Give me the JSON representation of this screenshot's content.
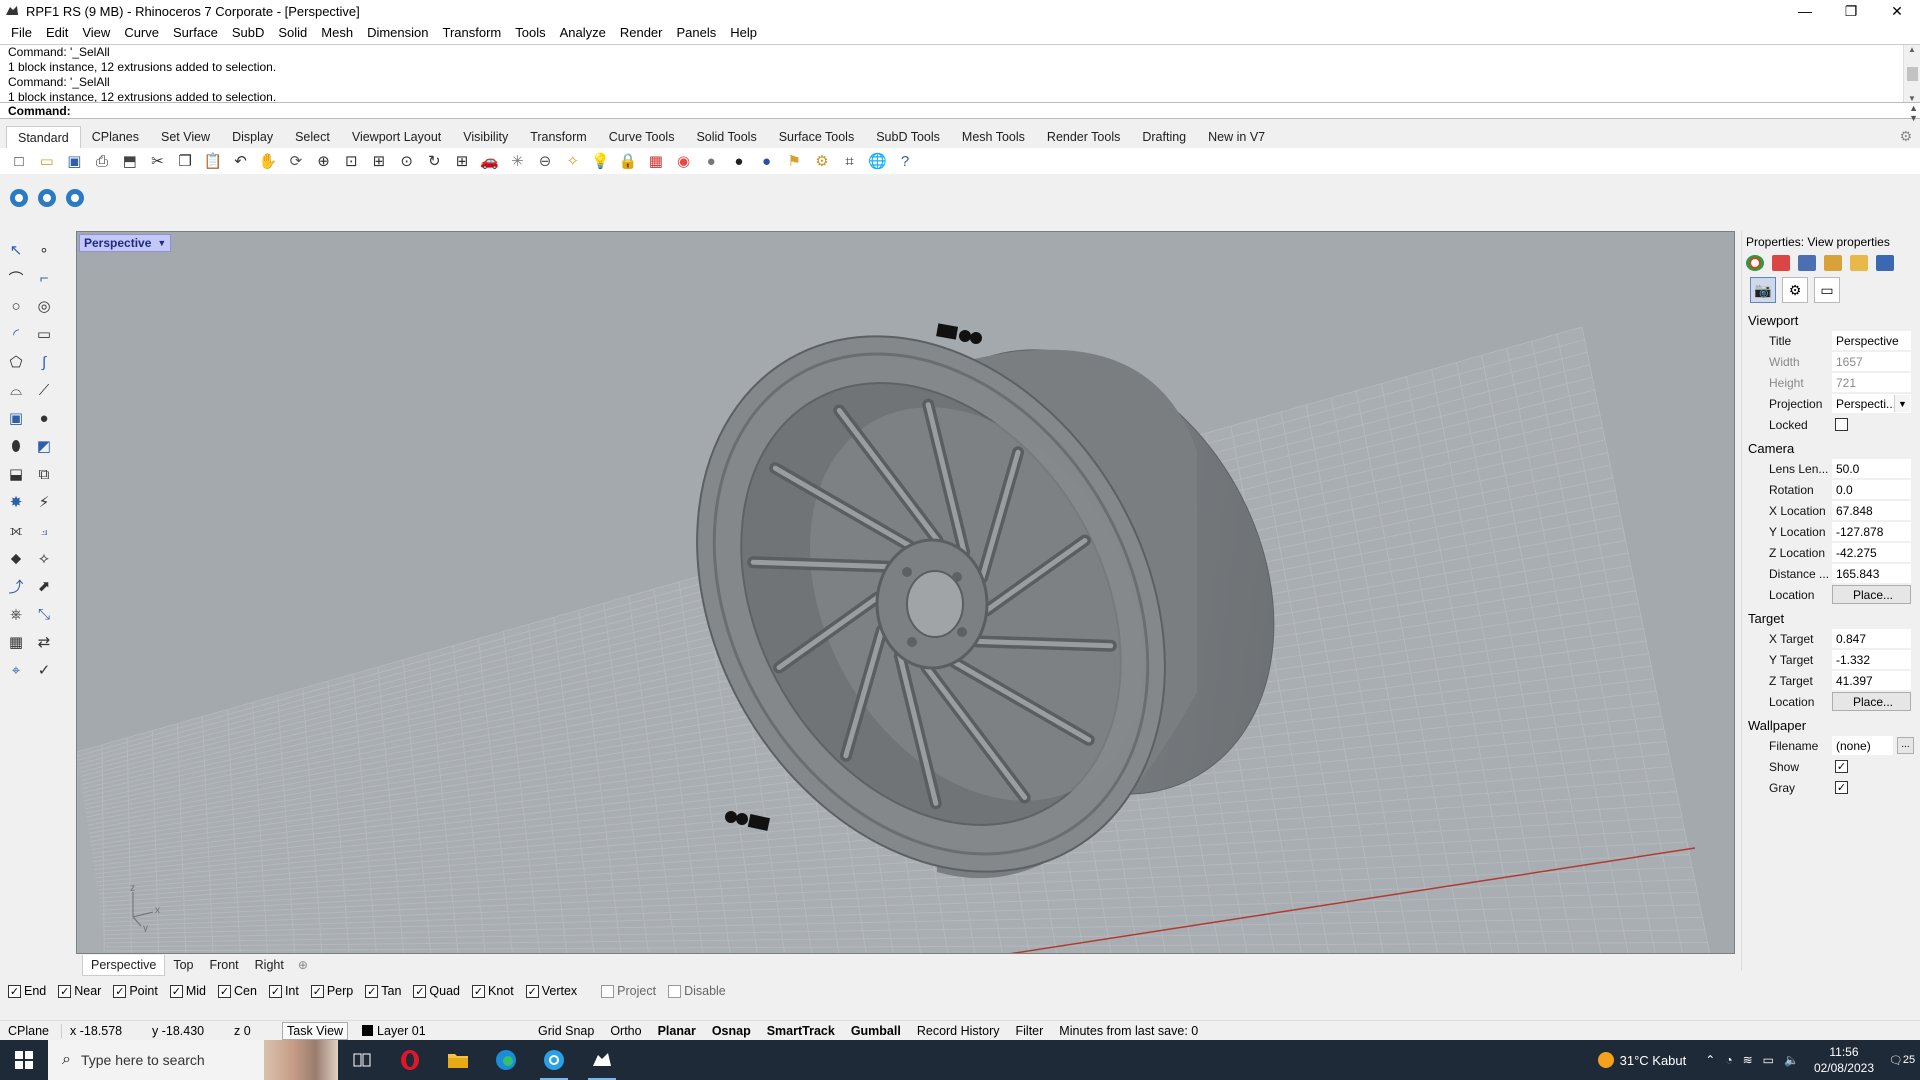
{
  "window": {
    "title": "RPF1 RS (9 MB) - Rhinoceros 7 Corporate - [Perspective]",
    "minimize_glyph": "—",
    "restore_glyph": "❐",
    "close_glyph": "✕"
  },
  "menu": [
    "File",
    "Edit",
    "View",
    "Curve",
    "Surface",
    "SubD",
    "Solid",
    "Mesh",
    "Dimension",
    "Transform",
    "Tools",
    "Analyze",
    "Render",
    "Panels",
    "Help"
  ],
  "command_history": [
    "Command: '_SelAll",
    "1 block instance, 12 extrusions added to selection.",
    "Command: '_SelAll",
    "1 block instance, 12 extrusions added to selection."
  ],
  "command_prompt": "Command:",
  "toolbar_tabs": [
    "Standard",
    "CPlanes",
    "Set View",
    "Display",
    "Select",
    "Viewport Layout",
    "Visibility",
    "Transform",
    "Curve Tools",
    "Solid Tools",
    "Surface Tools",
    "SubD Tools",
    "Mesh Tools",
    "Render Tools",
    "Drafting",
    "New in V7"
  ],
  "active_toolbar_tab": "Standard",
  "standard_icons": [
    "new-file-icon",
    "open-icon",
    "save-icon",
    "print-icon",
    "import-icon",
    "cut-icon",
    "copy-icon",
    "paste-icon",
    "undo-icon",
    "pan-icon",
    "rotate-view-icon",
    "zoom-icon",
    "zoom-window-icon",
    "zoom-extents-icon",
    "zoom-selected-icon",
    "redo-view-icon",
    "four-viewports-icon",
    "car-icon",
    "grasshopper-icon",
    "cplane-icon",
    "osnap-icon",
    "light-icon",
    "lock-icon",
    "layer-icon",
    "color-icon",
    "render-sphere-icon",
    "material-sphere-icon",
    "environment-sphere-icon",
    "filter-icon",
    "options-gear-icon",
    "dimension-icon",
    "globe-icon",
    "help-icon"
  ],
  "extra_icons": [
    "render-icon-1",
    "render-icon-2",
    "render-icon-3"
  ],
  "left_tools": [
    [
      "select-arrow-icon",
      "point-icon"
    ],
    [
      "polyline-icon",
      "curve-cv-icon"
    ],
    [
      "circle-icon",
      "ellipse-icon"
    ],
    [
      "arc-icon",
      "rectangle-icon"
    ],
    [
      "polygon-icon",
      "freeform-curve-icon"
    ],
    [
      "fillet-curve-icon",
      "offset-curve-icon"
    ],
    [
      "box-icon",
      "sphere-icon"
    ],
    [
      "cylinder-icon",
      "surface-icon"
    ],
    [
      "extrude-icon",
      "loft-icon"
    ],
    [
      "boolean-union-icon",
      "explode-icon"
    ],
    [
      "join-icon",
      "trim-icon"
    ],
    [
      "split-icon",
      "rebuild-icon"
    ],
    [
      "move-icon",
      "scale-icon"
    ],
    [
      "array-icon",
      "align-icon"
    ],
    [
      "dimension-icon",
      "check-icon"
    ],
    [
      "analyze-icon",
      "render-icon"
    ]
  ],
  "viewport": {
    "label": "Perspective",
    "axis_x": "x",
    "axis_y": "y",
    "axis_z": "z"
  },
  "viewport_tabs": [
    "Perspective",
    "Top",
    "Front",
    "Right"
  ],
  "active_viewport_tab": "Perspective",
  "viewport_tab_add": "⊕",
  "properties": {
    "panel_title": "Properties: View properties",
    "viewport_section": "Viewport",
    "title_label": "Title",
    "title_value": "Perspective",
    "width_label": "Width",
    "width_value": "1657",
    "height_label": "Height",
    "height_value": "721",
    "projection_label": "Projection",
    "projection_value": "Perspecti...",
    "locked_label": "Locked",
    "locked_checked": false,
    "camera_section": "Camera",
    "lens_label": "Lens Len...",
    "lens_value": "50.0",
    "rotation_label": "Rotation",
    "rotation_value": "0.0",
    "xloc_label": "X Location",
    "xloc_value": "67.848",
    "yloc_label": "Y Location",
    "yloc_value": "-127.878",
    "zloc_label": "Z Location",
    "zloc_value": "-42.275",
    "distance_label": "Distance ...",
    "distance_value": "165.843",
    "cam_location_label": "Location",
    "cam_place_button": "Place...",
    "target_section": "Target",
    "xtarget_label": "X Target",
    "xtarget_value": "0.847",
    "ytarget_label": "Y Target",
    "ytarget_value": "-1.332",
    "ztarget_label": "Z Target",
    "ztarget_value": "41.397",
    "tgt_location_label": "Location",
    "tgt_place_button": "Place...",
    "wallpaper_section": "Wallpaper",
    "filename_label": "Filename",
    "filename_value": "(none)",
    "filename_browse": "...",
    "show_label": "Show",
    "show_checked": true,
    "gray_label": "Gray",
    "gray_checked": true,
    "check_glyph": "✓"
  },
  "osnaps": [
    {
      "label": "End",
      "checked": true
    },
    {
      "label": "Near",
      "checked": true
    },
    {
      "label": "Point",
      "checked": true
    },
    {
      "label": "Mid",
      "checked": true
    },
    {
      "label": "Cen",
      "checked": true
    },
    {
      "label": "Int",
      "checked": true
    },
    {
      "label": "Perp",
      "checked": true
    },
    {
      "label": "Tan",
      "checked": true
    },
    {
      "label": "Quad",
      "checked": true
    },
    {
      "label": "Knot",
      "checked": true
    },
    {
      "label": "Vertex",
      "checked": true
    },
    {
      "label": "Project",
      "checked": false
    },
    {
      "label": "Disable",
      "checked": false
    }
  ],
  "status": {
    "cplane": "CPlane",
    "x": "x -18.578",
    "y": "y -18.430",
    "z": "z 0",
    "task_view": "Task View",
    "layer": "Layer 01",
    "grid_snap": "Grid Snap",
    "ortho": "Ortho",
    "planar": "Planar",
    "osnap": "Osnap",
    "smarttrack": "SmartTrack",
    "gumball": "Gumball",
    "record_history": "Record History",
    "filter": "Filter",
    "autosave": "Minutes from last save: 0"
  },
  "taskbar": {
    "search_placeholder": "Type here to search",
    "temperature": "31°C",
    "weather": "Kabut",
    "time": "11:56",
    "date": "02/08/2023",
    "notifications": "25"
  },
  "colors": {
    "viewport_bg": "#a4a9ae",
    "grid": "#b4b8bc",
    "x_axis": "#b03a30",
    "wheel": "#7b7f82",
    "taskbar": "#1f2a38"
  }
}
